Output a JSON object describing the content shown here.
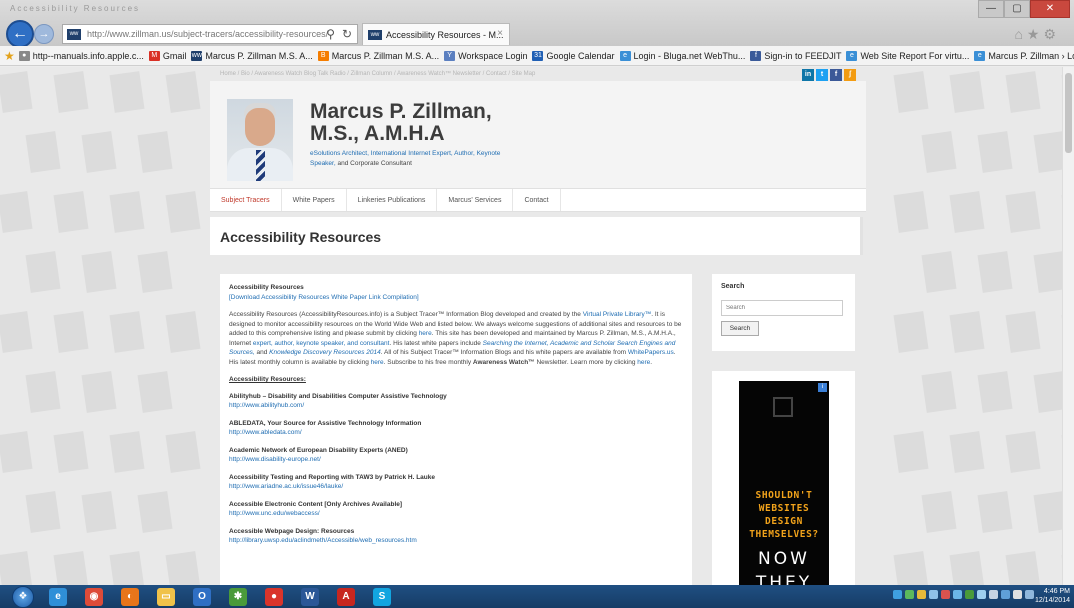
{
  "browser": {
    "window_ghost_text": "Accessibility Resources",
    "address_url": "http://www.zillman.us/subject-tracers/accessibility-resources/",
    "site_icon": "ww",
    "tab_title": "Accessibility Resources - M...",
    "tab_close": "×",
    "back": "←",
    "forward": "→",
    "search_glyph": "⚲",
    "refresh_glyph": "↻",
    "home_glyphs": "⌂★⚙",
    "window_controls": [
      "—",
      "▢",
      "✕"
    ],
    "favorites": [
      {
        "label": "http--manuals.info.apple.c...",
        "icon": "●",
        "color": "#888888"
      },
      {
        "label": "Gmail",
        "icon": "M",
        "color": "#d93025"
      },
      {
        "label": "Marcus P. Zillman  M.S.  A...",
        "icon": "ww",
        "color": "#1f3f6b"
      },
      {
        "label": "Marcus P. Zillman  M.S.  A...",
        "icon": "B",
        "color": "#f57d00"
      },
      {
        "label": "Workspace Login",
        "icon": "Y",
        "color": "#5b7fc0"
      },
      {
        "label": "Google Calendar",
        "icon": "31",
        "color": "#1f5fb4"
      },
      {
        "label": "Login - Bluga.net WebThu...",
        "icon": "e",
        "color": "#3a8fd6"
      },
      {
        "label": "Sign-in to FEEDJIT",
        "icon": "f",
        "color": "#3a5a99"
      },
      {
        "label": "Web Site Report For virtu...",
        "icon": "e",
        "color": "#3a8fd6"
      },
      {
        "label": "Marcus P. Zillman › Log In",
        "icon": "e",
        "color": "#3a8fd6"
      }
    ]
  },
  "site": {
    "topnav": "Home  /  Bio  /  Awareness Watch Blog Talk Radio  /  Zillman Column  /  Awareness Watch™ Newsletter  /  Contact  /  Site Map",
    "social": [
      {
        "label": "in",
        "color": "#0e76a8"
      },
      {
        "label": "t",
        "color": "#1da1f2"
      },
      {
        "label": "f",
        "color": "#3b5998"
      },
      {
        "label": "ʃ",
        "color": "#f39c12"
      }
    ],
    "name": "Marcus P. Zillman,",
    "credentials": "M.S., A.M.H.A",
    "tagline": "eSolutions Architect, International Internet Expert, Author, Keynote Speaker,",
    "tagline_end": " and Corporate Consultant",
    "menu": [
      "Subject Tracers",
      "White Papers",
      "Linkeries Publications",
      "Marcus' Services",
      "Contact"
    ],
    "page_title": "Accessibility Resources"
  },
  "content": {
    "title": "Accessibility Resources",
    "download_link": "[Download Accessibility Resources White Paper Link Compilation]",
    "para_1": "Accessibility Resources (AccessibilityResources.info) is a Subject Tracer™ Information Blog developed and created by the ",
    "para_vpl": "Virtual Private Library™",
    "para_2": ". It is designed to monitor accessibility resources on the World Wide Web and listed below. We always welcome suggestions of additional sites and resources to be added to this comprehensive listing and please submit by clicking ",
    "para_here": "here",
    "para_3": ". This site has been developed and maintained by Marcus P. Zillman, M.S., A.M.H.A., Internet ",
    "para_links": "expert, author, keynote speaker, and consultant",
    "para_4": ". His latest white papers include ",
    "para_wp": "Searching the Internet, Academic and Scholar Search Engines and Sources,",
    "para_5": " and ",
    "para_kd": "Knowledge Discovery Resources 2014",
    "para_6": ". All of his Subject Tracer™ Information Blogs and his white papers are available from ",
    "para_wpus": "WhitePapers.us",
    "para_7": ". His latest monthly column is available by clicking ",
    "para_here2": "here",
    "para_8": ". Subscribe to his free monthly ",
    "para_aw": "Awareness Watch™",
    "para_9": " Newsletter. Learn more by clicking ",
    "para_here3": "here",
    "para_end": ".",
    "resources_heading": "Accessibility Resources:",
    "resources": [
      {
        "name": "Abilityhub – Disability and Disabilities Computer Assistive Technology",
        "url": "http://www.abilityhub.com/"
      },
      {
        "name": "ABLEDATA, Your Source for Assistive Technology Information",
        "url": "http://www.abledata.com/"
      },
      {
        "name": "Academic Network of European Disability Experts (ANED)",
        "url": "http://www.disability-europe.net/"
      },
      {
        "name": "Accessibility Testing and Reporting with TAW3 by Patrick H. Lauke",
        "url": "http://www.ariadne.ac.uk/issue46/lauke/"
      },
      {
        "name": "Accessible Electronic Content [Only Archives Available]",
        "url": "http://www.unc.edu/webaccess/"
      },
      {
        "name": "Accessible Webpage Design: Resources",
        "url": "http://library.uwsp.edu/aclindmeth/Accessible/web_resources.htm"
      }
    ]
  },
  "sidebar": {
    "search_heading": "Search",
    "search_placeholder": "Search",
    "search_button": "Search",
    "ad_badge": "i",
    "ad_lines": [
      "SHOULDN'T",
      "WEBSITES",
      "DESIGN",
      "THEMSELVES?"
    ],
    "ad_now": "NOW",
    "ad_they": "THEY"
  },
  "taskbar": {
    "start_glyph": "❖",
    "apps": [
      {
        "name": "ie",
        "glyph": "e",
        "color": "#2f8fd8"
      },
      {
        "name": "chrome",
        "glyph": "◉",
        "color": "#dd4b39"
      },
      {
        "name": "firefox",
        "glyph": "◐",
        "color": "#e8751a"
      },
      {
        "name": "explorer",
        "glyph": "▭",
        "color": "#f0c24a"
      },
      {
        "name": "outlook",
        "glyph": "O",
        "color": "#2f6fc4"
      },
      {
        "name": "app-gear",
        "glyph": "✱",
        "color": "#4a9a3a"
      },
      {
        "name": "app-red",
        "glyph": "●",
        "color": "#d9342b"
      },
      {
        "name": "word",
        "glyph": "W",
        "color": "#2b5797"
      },
      {
        "name": "acrobat",
        "glyph": "A",
        "color": "#c7261f"
      },
      {
        "name": "skype",
        "glyph": "S",
        "color": "#12a5e0"
      }
    ],
    "time": "4:46 PM",
    "date": "12/14/2014"
  }
}
